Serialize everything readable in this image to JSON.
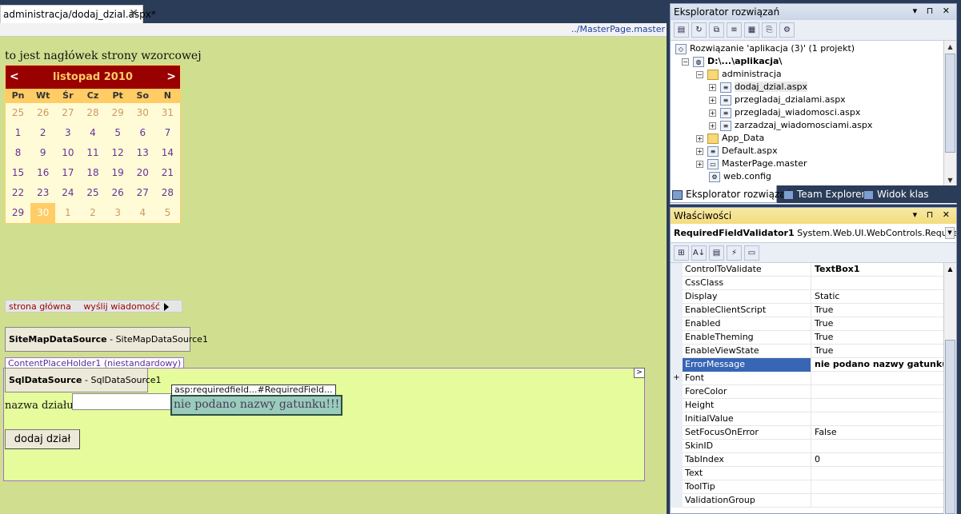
{
  "document_tab": {
    "title": "administracja/dodaj_dzial.aspx*",
    "close": "✕"
  },
  "master_link": "../MasterPage.master",
  "page": {
    "header_text": "to jest nagłówek strony wzorcowej",
    "calendar": {
      "title": "listopad 2010",
      "prev": "<",
      "next": ">",
      "day_names": [
        "Pn",
        "Wt",
        "Śr",
        "Cz",
        "Pt",
        "So",
        "N"
      ],
      "weeks": [
        [
          "25",
          "26",
          "27",
          "28",
          "29",
          "30",
          "31"
        ],
        [
          "1",
          "2",
          "3",
          "4",
          "5",
          "6",
          "7"
        ],
        [
          "8",
          "9",
          "10",
          "11",
          "12",
          "13",
          "14"
        ],
        [
          "15",
          "16",
          "17",
          "18",
          "19",
          "20",
          "21"
        ],
        [
          "22",
          "23",
          "24",
          "25",
          "26",
          "27",
          "28"
        ],
        [
          "29",
          "30",
          "1",
          "2",
          "3",
          "4",
          "5"
        ]
      ],
      "selected_day": "30"
    },
    "menu": {
      "items": [
        "strona główna",
        "wyślij wiadomość"
      ]
    },
    "sitemap_ds": {
      "type": "SiteMapDataSource",
      "id": " - SiteMapDataSource1"
    },
    "content_placeholder": {
      "label": "ContentPlaceHolder1 (niestandardowy)",
      "toggle": ">"
    },
    "sql_ds": {
      "type": "SqlDataSource",
      "id": " - SqlDataSource1"
    },
    "form": {
      "nazwa_label": "nazwa działu:",
      "nazwa_value": "",
      "validator_tag": "asp:requiredfield...#RequiredField...",
      "validator_message": "nie podano nazwy gatunku!!!",
      "submit": "dodaj dział"
    }
  },
  "solution_explorer": {
    "title": "Eksplorator rozwiązań",
    "controls": "▾ ⊓ ✕",
    "tree": [
      {
        "label": "Rozwiązanie 'aplikacja (3)' (1 projekt)",
        "icon": "solution-icon",
        "expander": "",
        "level": 0
      },
      {
        "label": "D:\\...\\aplikacja\\",
        "icon": "web-project-icon",
        "expander": "−",
        "level": 1,
        "bold": true
      },
      {
        "label": "administracja",
        "icon": "folder-icon",
        "expander": "−",
        "level": 2
      },
      {
        "label": "dodaj_dzial.aspx",
        "icon": "aspx-icon",
        "expander": "+",
        "level": 3,
        "selected": true
      },
      {
        "label": "przegladaj_dzialami.aspx",
        "icon": "aspx-icon",
        "expander": "+",
        "level": 3
      },
      {
        "label": "przegladaj_wiadomosci.aspx",
        "icon": "aspx-icon",
        "expander": "+",
        "level": 3
      },
      {
        "label": "zarzadzaj_wiadomosciami.aspx",
        "icon": "aspx-icon",
        "expander": "+",
        "level": 3
      },
      {
        "label": "App_Data",
        "icon": "folder-icon",
        "expander": "+",
        "level": 2
      },
      {
        "label": "Default.aspx",
        "icon": "aspx-icon",
        "expander": "+",
        "level": 2
      },
      {
        "label": "MasterPage.master",
        "icon": "master-icon",
        "expander": "+",
        "level": 2
      },
      {
        "label": "web.config",
        "icon": "config-icon",
        "expander": "",
        "level": 2
      }
    ],
    "bottom_tabs": [
      "Eksplorator rozwiązań",
      "Team Explorer",
      "Widok klas"
    ]
  },
  "properties": {
    "title": "Właściwości",
    "controls": "▾ ⊓ ✕",
    "object_name": "RequiredFieldValidator1",
    "object_type": " System.Web.UI.WebControls.RequiredFi",
    "rows": [
      {
        "name": "ControlToValidate",
        "value": "TextBox1",
        "bold": true
      },
      {
        "name": "CssClass",
        "value": ""
      },
      {
        "name": "Display",
        "value": "Static"
      },
      {
        "name": "EnableClientScript",
        "value": "True"
      },
      {
        "name": "Enabled",
        "value": "True"
      },
      {
        "name": "EnableTheming",
        "value": "True"
      },
      {
        "name": "EnableViewState",
        "value": "True"
      },
      {
        "name": "ErrorMessage",
        "value": "nie podano nazwy gatunku!!!",
        "bold": true,
        "selected": true
      },
      {
        "name": "Font",
        "value": "",
        "expander": "+"
      },
      {
        "name": "ForeColor",
        "value": ""
      },
      {
        "name": "Height",
        "value": ""
      },
      {
        "name": "InitialValue",
        "value": ""
      },
      {
        "name": "SetFocusOnError",
        "value": "False"
      },
      {
        "name": "SkinID",
        "value": ""
      },
      {
        "name": "TabIndex",
        "value": "0"
      },
      {
        "name": "Text",
        "value": ""
      },
      {
        "name": "ToolTip",
        "value": ""
      },
      {
        "name": "ValidationGroup",
        "value": ""
      }
    ]
  },
  "colors": {
    "designer_bg": "#d0df8f",
    "calendar_header": "#990000",
    "calendar_day_bar": "#ffcc66",
    "placeholder_bg": "#e5fb9c",
    "validator_bg": "#99ccbb",
    "ide_dark": "#2b3c59",
    "selection_blue": "#3866b5"
  }
}
